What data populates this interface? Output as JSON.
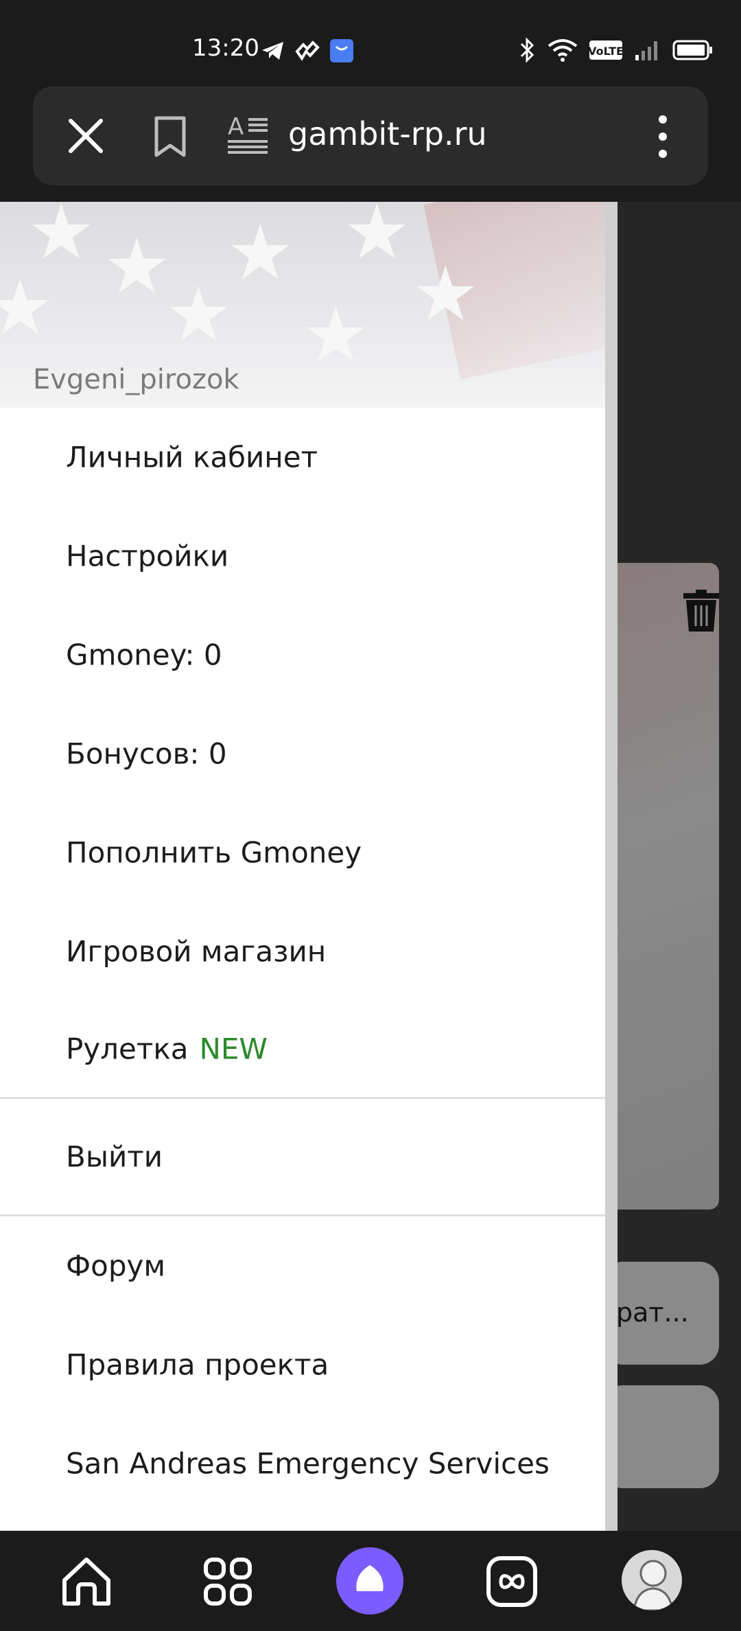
{
  "status_bar": {
    "time": "13:20"
  },
  "browser": {
    "url": "gambit-rp.ru"
  },
  "drawer": {
    "username": "Evgeni_pirozok",
    "items": [
      {
        "label": "Личный кабинет"
      },
      {
        "label": "Настройки"
      },
      {
        "label": "Gmoney: 0"
      },
      {
        "label": "Бонусов: 0"
      },
      {
        "label": "Пополнить Gmoney"
      },
      {
        "label": "Игровой магазин"
      },
      {
        "label": "Рулетка",
        "badge": "NEW"
      }
    ],
    "logout": "Выйти",
    "links": [
      {
        "label": "Форум"
      },
      {
        "label": "Правила проекта"
      },
      {
        "label": "San Andreas Emergency Services"
      }
    ]
  },
  "background_page": {
    "button_partial_text": "рат..."
  },
  "colors": {
    "badge_new": "#2b8a2b",
    "alice_accent": "#7b5cff"
  },
  "icons": {
    "url_bar": [
      "close-icon",
      "bookmark-icon",
      "reader-mode-icon",
      "more-vert-icon"
    ],
    "bottom_nav": [
      "home-icon",
      "apps-grid-icon",
      "alice-assistant-icon",
      "tabs-icon",
      "profile-avatar"
    ]
  }
}
